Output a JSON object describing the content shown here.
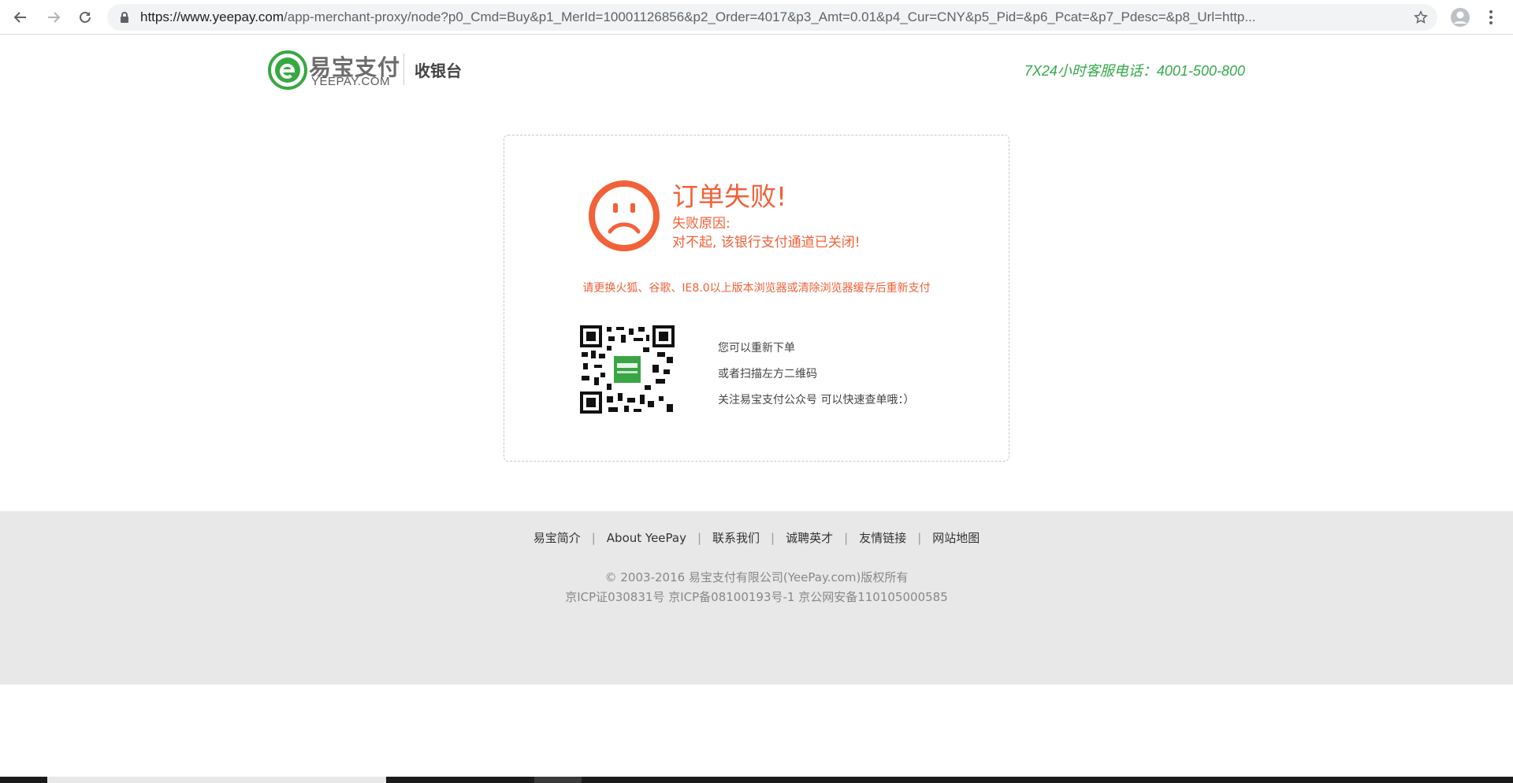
{
  "browser": {
    "url_host": "https://www.yeepay.com",
    "url_path": "/app-merchant-proxy/node?p0_Cmd=Buy&p1_MerId=10001126856&p2_Order=4017&p3_Amt=0.01&p4_Cur=CNY&p5_Pid=&p6_Pcat=&p7_Pdesc=&p8_Url=http..."
  },
  "header": {
    "logo_cn": "易宝支付",
    "logo_en": "YEEPAY.COM",
    "subtitle": "收银台",
    "hotline": "7X24小时客服电话：4001-500-800"
  },
  "result": {
    "title": "订单失败!",
    "reason_label": "失败原因:",
    "reason_text": "对不起, 该银行支付通道已关闭!",
    "browser_tip": "请更换火狐、谷歌、IE8.0以上版本浏览器或清除浏览器缓存后重新支付",
    "qr_lines": [
      "您可以重新下单",
      "或者扫描左方二维码",
      "关注易宝支付公众号 可以快速查单哦：）"
    ]
  },
  "footer": {
    "links": [
      "易宝简介",
      "About YeePay",
      "联系我们",
      "诚聘英才",
      "友情链接",
      "网站地图"
    ],
    "separator": "|",
    "copyright": "© 2003-2016 易宝支付有限公司(YeePay.com)版权所有",
    "icp": "京ICP证030831号 京ICP备08100193号-1 京公网安备110105000585"
  },
  "colors": {
    "error": "#f26138",
    "brand_green": "#35a94a",
    "footer_bg": "#e8e8e8"
  },
  "icons": {
    "back": "arrow-left-icon",
    "forward": "arrow-right-icon",
    "reload": "reload-icon",
    "lock": "lock-icon",
    "bookmark": "star-icon",
    "profile": "account-icon",
    "menu": "more-vert-icon",
    "status": "sad-face-icon",
    "qr": "qr-code-icon"
  }
}
